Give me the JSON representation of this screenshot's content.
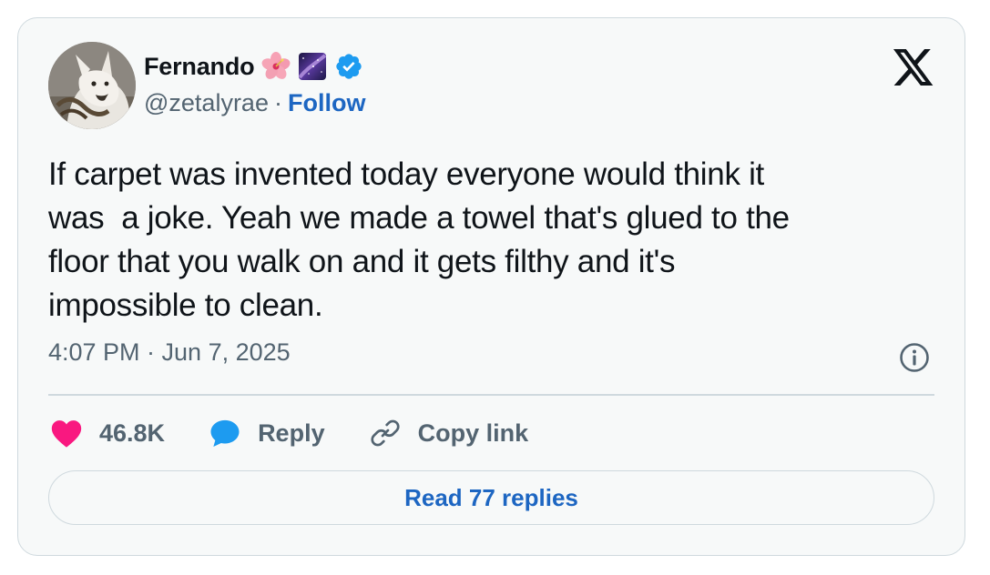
{
  "author": {
    "display_name": "Fernando",
    "handle": "@zetalyrae",
    "separator": "·",
    "follow_label": "Follow",
    "emojis": [
      "hibiscus-emoji",
      "milky-way-emoji"
    ],
    "verified": true
  },
  "tweet": {
    "text": "If carpet was invented today everyone would think it\nwas  a joke. Yeah we made a towel that's glued to the\nfloor that you walk on and it gets filthy and it's\nimpossible to clean.",
    "timestamp": "4:07 PM · Jun 7, 2025"
  },
  "actions": {
    "likes_count": "46.8K",
    "reply_label": "Reply",
    "copy_link_label": "Copy link"
  },
  "read_replies_label": "Read 77 replies",
  "colors": {
    "background": "#f7f9f9",
    "border": "#cfd9de",
    "text": "#0f1419",
    "muted": "#536471",
    "link": "#1d66c2",
    "heart": "#f91880",
    "verified": "#1d9bf0",
    "reply_bubble": "#1d9bf0"
  },
  "icons": {
    "platform_logo": "x-logo-icon",
    "info": "info-icon",
    "like": "heart-icon",
    "reply": "speech-bubble-icon",
    "copy_link": "link-icon"
  }
}
